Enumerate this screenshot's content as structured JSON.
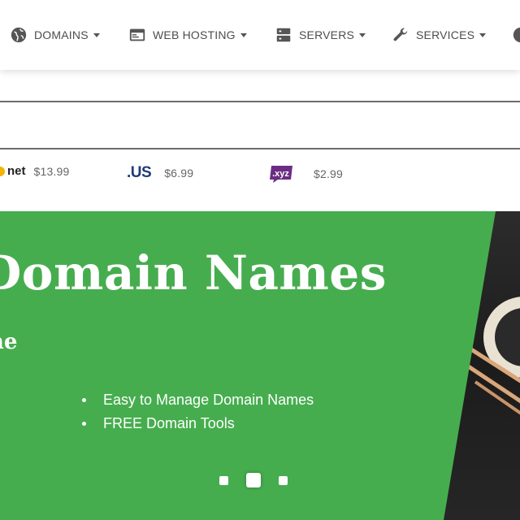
{
  "nav": {
    "items": [
      {
        "label": "DOMAINS",
        "icon": "globe-icon"
      },
      {
        "label": "WEB HOSTING",
        "icon": "browser-window-icon"
      },
      {
        "label": "SERVERS",
        "icon": "server-icon"
      },
      {
        "label": "SERVICES",
        "icon": "wrench-icon"
      }
    ]
  },
  "search": {
    "value": "",
    "placeholder": ""
  },
  "tlds": [
    {
      "name": "net",
      "price": "$13.99"
    },
    {
      "name": ".US",
      "price": "$6.99"
    },
    {
      "name": ".xyz",
      "price": "$2.99"
    }
  ],
  "hero": {
    "title": "Domain Names",
    "subtitle": "ne",
    "bullets": [
      "Easy to Manage Domain Names",
      "FREE Domain Tools"
    ],
    "slide_count": 3,
    "active_slide": 2
  },
  "colors": {
    "hero_green": "#46ad4e",
    "nav_text": "#4d4d4d",
    "net_dot": "#f4b400",
    "us_blue": "#1f3b76",
    "xyz_purple": "#6b2d83"
  }
}
